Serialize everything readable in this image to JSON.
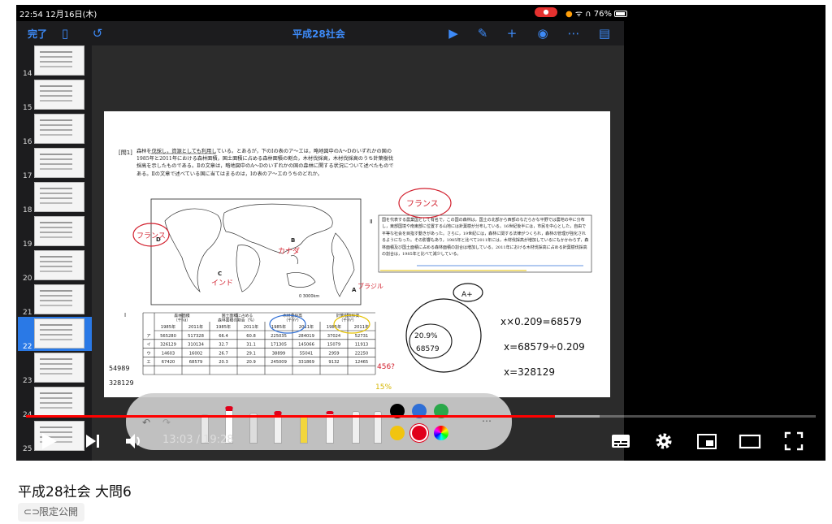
{
  "statusbar": {
    "time": "22:54 12月16日(木)",
    "battery": "76%"
  },
  "app": {
    "done": "完了",
    "title": "平成28社会"
  },
  "thumbs": [
    "14",
    "15",
    "16",
    "17",
    "18",
    "19",
    "20",
    "21",
    "22",
    "23",
    "24",
    "25"
  ],
  "selected_thumb": "22",
  "document": {
    "question_label": "[問1]",
    "question_text": "森林を伐採し，資源としても利用している。とあるが，下のⅠの表のア～エは，略地図中のA～Dのいずれかの国の1985年と2011年における森林面積，国土面積に占める森林面積の割合，木材伐採高，木材伐採高のうち針葉樹伐採高を示したものである。Ⅱの文章は，略地図中のA～Dのいずれかの国の森林に関する状況について述べたものである。Ⅱの文章で述べている国に当てはまるのは，Ⅰの表のア～エのうちのどれか。",
    "passage_label": "Ⅱ",
    "passage_text": "国を代表する農業国として有名で，この国の森林は，国土の北部から西部のなだらかな平野では農地の中に分布し，東部国境や南東部に位置する山地には針葉樹が分布している。16世紀後半には，市民を中心とした，自由で平等な社会を目指す動きがあった。さらに，19世紀には，森林に関する法律がつくられ，森林の管理が強化されるようになった。その影響もあり，1985年と比べて2011年には，木材伐採高が増加しているにもかかわらず，森林面積及び国土面積に占める森林面積の割合は増加している。2011年における木材伐採高に占める針葉樹伐採高の割合は，1985年と比べて減少している。",
    "map_labels": [
      "A",
      "B",
      "C",
      "D"
    ],
    "scale": "0  3000km",
    "table_label": "Ⅰ",
    "table_headers": [
      "森林面積\n（千ha）",
      "国土面積に占める\n森林面積の割合（%）",
      "木材伐採高\n（千m³）",
      "針葉樹伐採高\n（千m³）"
    ],
    "year_headers": [
      "1985年",
      "2011年",
      "1985年",
      "2011年",
      "1985年",
      "2011年",
      "1985年",
      "2011年"
    ],
    "rows": [
      {
        "label": "ア",
        "values": [
          "565280",
          "517328",
          "66.4",
          "60.8",
          "225035",
          "284019",
          "37024",
          "52731"
        ]
      },
      {
        "label": "イ",
        "values": [
          "326129",
          "310134",
          "32.7",
          "31.1",
          "171305",
          "145066",
          "15079",
          "11913"
        ]
      },
      {
        "label": "ウ",
        "values": [
          "14603",
          "16002",
          "26.7",
          "29.1",
          "38899",
          "55041",
          "2959",
          "22250"
        ]
      },
      {
        "label": "エ",
        "values": [
          "67420",
          "68579",
          "20.3",
          "20.9",
          "245009",
          "331869",
          "9132",
          "12465"
        ]
      }
    ]
  },
  "annotations": {
    "france_top": "フランス",
    "france_left": "フランス",
    "canada": "カナダ",
    "india": "インド",
    "brazil": "ブラジル",
    "oval_top": "A+",
    "oval_pct": "20.9%",
    "oval_val": "68579",
    "eq1": "x×0.209=68579",
    "eq2": "x=68579÷0.209",
    "eq3": "x=328129",
    "left1": "54989",
    "left2": "328129",
    "note1": "456?",
    "note2": "15%"
  },
  "pen_colors": [
    "#000000",
    "#2f6fd6",
    "#2aa84a",
    "#f1c40f",
    "#e0001a"
  ],
  "player": {
    "current": "13:03",
    "duration": "19:28",
    "time_display": "13:03 / 19:28",
    "progress": 0.67,
    "buffered": 0.726
  },
  "video": {
    "title": "平成28社会 大問6",
    "visibility": "限定公開"
  }
}
